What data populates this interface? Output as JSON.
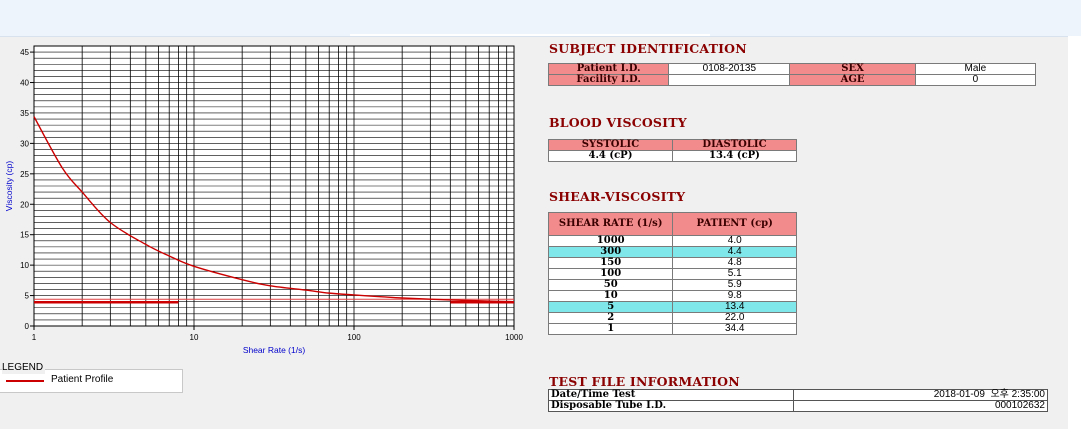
{
  "chart_data": {
    "type": "line",
    "title": "",
    "xlabel": "Shear Rate (1/s)",
    "ylabel": "Viscosity (cp)",
    "xscale": "log",
    "xlim": [
      1,
      1000
    ],
    "ylim": [
      0,
      46
    ],
    "x_ticks": [
      "1",
      "10",
      "100",
      "1000"
    ],
    "y_ticks": [
      "0",
      "5",
      "10",
      "15",
      "20",
      "25",
      "30",
      "35",
      "40",
      "45"
    ],
    "grid": true,
    "series": [
      {
        "name": "Patient Profile",
        "color": "#cc0000",
        "x": [
          1,
          1.5,
          2,
          3,
          5,
          7,
          10,
          20,
          30,
          50,
          70,
          100,
          150,
          200,
          300,
          500,
          700,
          1000
        ],
        "y": [
          34.4,
          26.0,
          22.0,
          17.0,
          13.4,
          11.5,
          9.8,
          7.6,
          6.6,
          5.9,
          5.4,
          5.1,
          4.8,
          4.6,
          4.4,
          4.2,
          4.1,
          4.0
        ]
      }
    ],
    "reference_lines": [
      {
        "y": 4.4,
        "x_range": [
          1,
          1000
        ],
        "color": "#e04040",
        "width": "thin"
      },
      {
        "y": 3.9,
        "x_range": [
          1,
          8
        ],
        "color": "#cc0000",
        "width": "thick"
      },
      {
        "y": 3.9,
        "x_range": [
          400,
          1000
        ],
        "color": "#cc0000",
        "width": "thick"
      }
    ]
  },
  "legend": {
    "title": "LEGEND",
    "items": [
      {
        "label": "Patient Profile",
        "color": "#cc0000"
      }
    ]
  },
  "subject": {
    "heading": "SUBJECT IDENTIFICATION",
    "patient_id_label": "Patient I.D.",
    "patient_id_value": "0108-20135",
    "facility_id_label": "Facility I.D.",
    "facility_id_value": "",
    "sex_label": "SEX",
    "sex_value": "Male",
    "age_label": "AGE",
    "age_value": "0"
  },
  "blood": {
    "heading": "BLOOD VISCOSITY",
    "systolic_label": "SYSTOLIC",
    "diastolic_label": "DIASTOLIC",
    "systolic_value": "4.4 (cP)",
    "diastolic_value": "13.4 (cP)"
  },
  "shear": {
    "heading": "SHEAR-VISCOSITY",
    "col1": "SHEAR RATE (1/s)",
    "col2": "PATIENT (cp)",
    "rows": [
      {
        "rate": "1000",
        "value": "4.0",
        "highlight": false
      },
      {
        "rate": "300",
        "value": "4.4",
        "highlight": true
      },
      {
        "rate": "150",
        "value": "4.8",
        "highlight": false
      },
      {
        "rate": "100",
        "value": "5.1",
        "highlight": false
      },
      {
        "rate": "50",
        "value": "5.9",
        "highlight": false
      },
      {
        "rate": "10",
        "value": "9.8",
        "highlight": false
      },
      {
        "rate": "5",
        "value": "13.4",
        "highlight": true
      },
      {
        "rate": "2",
        "value": "22.0",
        "highlight": false
      },
      {
        "rate": "1",
        "value": "34.4",
        "highlight": false
      }
    ]
  },
  "testfile": {
    "heading": "TEST FILE INFORMATION",
    "date_label": "Date/Time Test",
    "date_value": "2018-01-09  오후 2:35:00",
    "tube_label": "Disposable Tube I.D.",
    "tube_value": "000102632"
  },
  "colors": {
    "header_fill": "#f28b8b",
    "highlight_fill": "#7fe6ea",
    "heading_text": "#8b0000",
    "curve": "#cc0000"
  }
}
